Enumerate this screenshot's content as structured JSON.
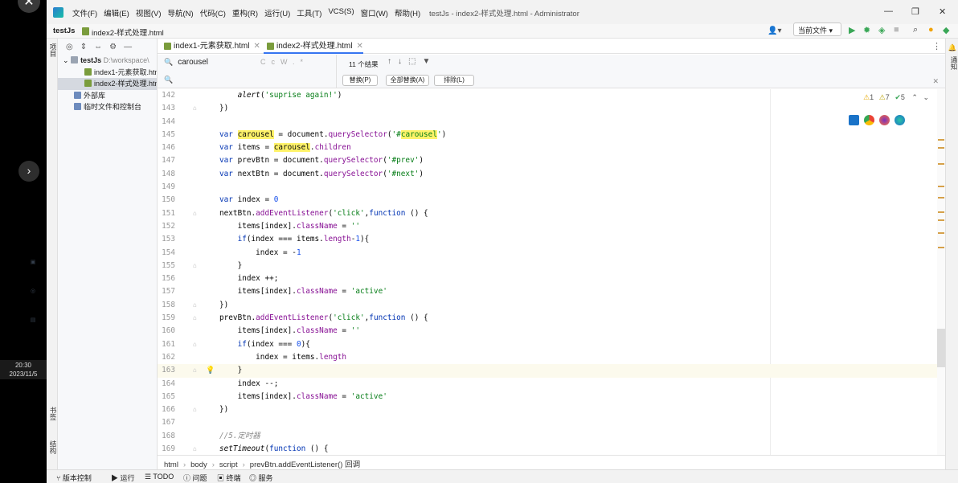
{
  "overlay": {
    "close_glyph": "✕",
    "next_glyph": "›",
    "clock_time": "20:30",
    "clock_date": "2023/11/5"
  },
  "menu": {
    "items": [
      "文件(F)",
      "编辑(E)",
      "视图(V)",
      "导航(N)",
      "代码(C)",
      "重构(R)",
      "运行(U)",
      "工具(T)",
      "VCS(S)",
      "窗口(W)",
      "帮助(H)"
    ],
    "window_title": "testJs - index2-样式处理.html - Administrator"
  },
  "navbar": {
    "project": "testJs",
    "file": "index2-样式处理.html",
    "run_config": "当前文件"
  },
  "tool_strips": {
    "project_label": "项目",
    "bookmarks_label": "书签",
    "structure_label": "结构",
    "notifications_label": "通知"
  },
  "project_tree": {
    "root_name": "testJs",
    "root_path": "D:\\workspace\\",
    "files": [
      "index1-元素获取.html",
      "index2-样式处理.html"
    ],
    "external_libs": "外部库",
    "scratches": "临时文件和控制台"
  },
  "tabs": [
    "index1-元素获取.html",
    "index2-样式处理.html"
  ],
  "find": {
    "query": "carousel",
    "result_count": "11 个结果",
    "opt_case": "Cc",
    "opt_word": "W",
    "opt_regex": ".*",
    "replace_btn": "替换(P)",
    "replace_all_btn": "全部替换(A)",
    "exclude_btn": "排除(L)"
  },
  "inspections": {
    "warnings_1": "1",
    "warnings_2": "7",
    "ok": "5"
  },
  "code": {
    "lines": [
      {
        "n": "142",
        "text": "        alert('suprise again!')"
      },
      {
        "n": "143",
        "text": "    })"
      },
      {
        "n": "144",
        "text": ""
      },
      {
        "n": "145",
        "text": "    var carousel = document.querySelector('#carousel')"
      },
      {
        "n": "146",
        "text": "    var items = carousel.children"
      },
      {
        "n": "147",
        "text": "    var prevBtn = document.querySelector('#prev')"
      },
      {
        "n": "148",
        "text": "    var nextBtn = document.querySelector('#next')"
      },
      {
        "n": "149",
        "text": ""
      },
      {
        "n": "150",
        "text": "    var index = 0"
      },
      {
        "n": "151",
        "text": "    nextBtn.addEventListener('click',function () {"
      },
      {
        "n": "152",
        "text": "        items[index].className = ''"
      },
      {
        "n": "153",
        "text": "        if(index === items.length-1){"
      },
      {
        "n": "154",
        "text": "            index = -1"
      },
      {
        "n": "155",
        "text": "        }"
      },
      {
        "n": "156",
        "text": "        index ++;"
      },
      {
        "n": "157",
        "text": "        items[index].className = 'active'"
      },
      {
        "n": "158",
        "text": "    })"
      },
      {
        "n": "159",
        "text": "    prevBtn.addEventListener('click',function () {"
      },
      {
        "n": "160",
        "text": "        items[index].className = ''"
      },
      {
        "n": "161",
        "text": "        if(index === 0){"
      },
      {
        "n": "162",
        "text": "            index = items.length"
      },
      {
        "n": "163",
        "text": "        }"
      },
      {
        "n": "164",
        "text": "        index --;"
      },
      {
        "n": "165",
        "text": "        items[index].className = 'active'"
      },
      {
        "n": "166",
        "text": "    })"
      },
      {
        "n": "167",
        "text": ""
      },
      {
        "n": "168",
        "text": "    //5.定时器"
      },
      {
        "n": "169",
        "text": "    setTimeout(function () {"
      }
    ]
  },
  "breadcrumb": [
    "html",
    "body",
    "script",
    "prevBtn.addEventListener() 回调"
  ],
  "statusbar": [
    "版本控制",
    "运行",
    "TODO",
    "问题",
    "终端",
    "服务"
  ],
  "colors": {
    "accent": "#3574f0",
    "keyword": "#0033b3",
    "string": "#067d17",
    "number": "#1750eb",
    "property": "#871094",
    "comment": "#8c8c8c",
    "search_highlight": "#fff36a"
  }
}
